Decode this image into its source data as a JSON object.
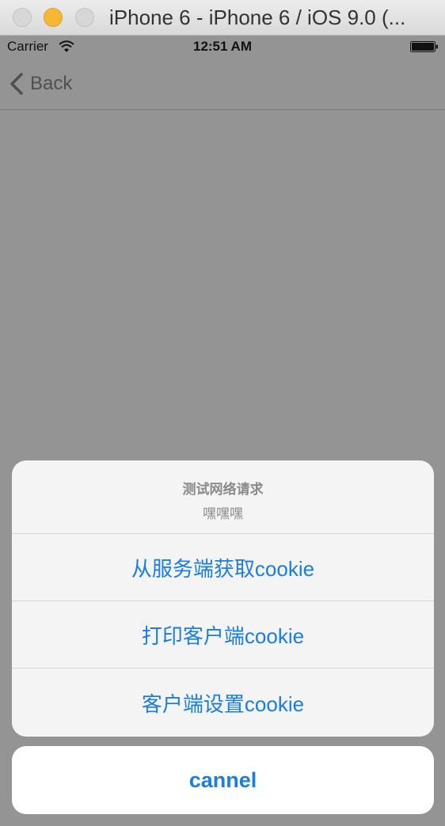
{
  "window": {
    "title": "iPhone 6 - iPhone 6 / iOS 9.0 (..."
  },
  "status_bar": {
    "carrier": "Carrier",
    "time": "12:51 AM",
    "icons": [
      "wifi-icon",
      "battery-icon"
    ]
  },
  "nav_bar": {
    "back_label": "Back",
    "back_icon": "chevron-left-icon"
  },
  "action_sheet": {
    "title": "测试网络请求",
    "message": "嘿嘿嘿",
    "actions": [
      {
        "label": "从服务端获取cookie"
      },
      {
        "label": "打印客户端cookie"
      },
      {
        "label": "客户端设置cookie"
      }
    ],
    "cancel_label": "cannel",
    "accent_color": "#1a7ee0"
  }
}
